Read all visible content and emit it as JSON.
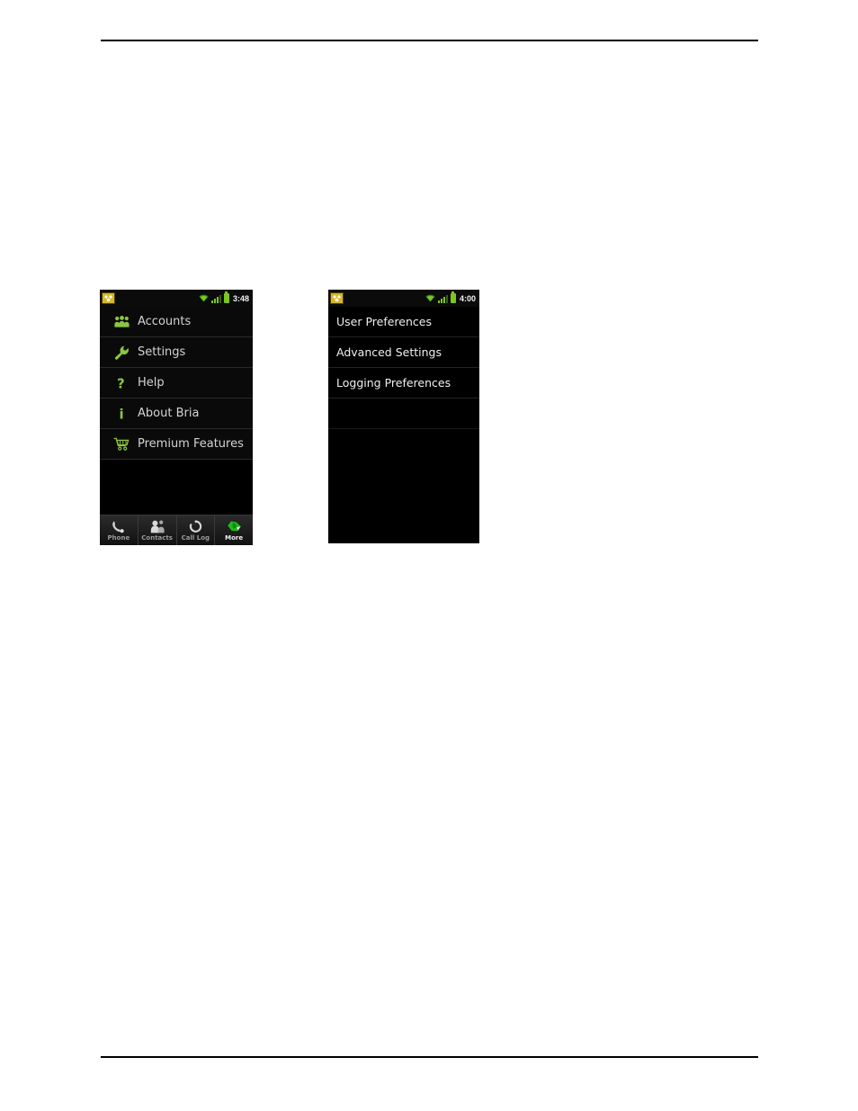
{
  "page": {
    "header_text": "",
    "footer_text": ""
  },
  "phone_more": {
    "status_bar": {
      "notification_icon": "app-notification-icon",
      "wifi_icon": "wifi-icon",
      "signal_icon": "cellular-signal-icon",
      "battery_icon": "battery-icon",
      "time": "3:48"
    },
    "menu_items": [
      {
        "label": "Accounts",
        "icon": "accounts-people-icon"
      },
      {
        "label": "Settings",
        "icon": "wrench-icon"
      },
      {
        "label": "Help",
        "icon": "question-mark-icon"
      },
      {
        "label": "About Bria",
        "icon": "info-icon"
      },
      {
        "label": "Premium Features",
        "icon": "shopping-cart-icon"
      }
    ],
    "tabs": [
      {
        "label": "Phone",
        "icon": "handset-icon",
        "active": false
      },
      {
        "label": "Contacts",
        "icon": "contacts-people-icon",
        "active": false
      },
      {
        "label": "Call Log",
        "icon": "call-log-arrows-icon",
        "active": false
      },
      {
        "label": "More",
        "icon": "more-leaf-icon",
        "active": true
      }
    ]
  },
  "phone_settings": {
    "status_bar": {
      "notification_icon": "app-notification-icon",
      "wifi_icon": "wifi-icon",
      "signal_icon": "cellular-signal-icon",
      "battery_icon": "battery-icon",
      "time": "4:00"
    },
    "menu_items": [
      {
        "label": "User Preferences"
      },
      {
        "label": "Advanced Settings"
      },
      {
        "label": "Logging Preferences"
      }
    ]
  },
  "colors": {
    "accent_green": "#8bc63e",
    "active_tab_green": "#22b81e",
    "screen_background": "#000000",
    "status_bar_background": "#0b0b0b",
    "list_text": "#d4d4d4"
  }
}
